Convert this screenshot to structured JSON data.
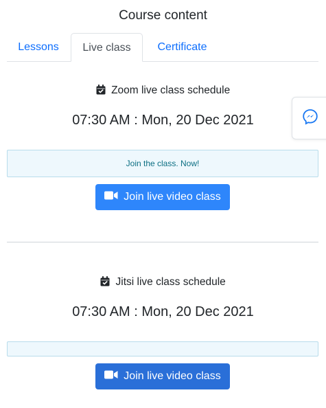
{
  "page": {
    "title": "Course content"
  },
  "tabs": [
    {
      "label": "Lessons",
      "active": false
    },
    {
      "label": "Live class",
      "active": true
    },
    {
      "label": "Certificate",
      "active": false
    }
  ],
  "zoom": {
    "heading": "Zoom live class schedule",
    "time": "07:30 AM : Mon, 20 Dec 2021",
    "alert": "Join the class. Now!",
    "button_label": "Join live video class"
  },
  "jitsi": {
    "heading": "Jitsi live class schedule",
    "time": "07:30 AM : Mon, 20 Dec 2021",
    "alert": "",
    "button_label": "Join live video class"
  },
  "icons": {
    "calendar": "calendar-check-icon",
    "video": "video-camera-icon",
    "messenger": "messenger-icon"
  },
  "colors": {
    "link": "#0d6efd",
    "button": "#2e86fb",
    "alert_bg": "#eef8fd",
    "alert_text": "#0b6e82",
    "messenger": "#1877f2"
  }
}
